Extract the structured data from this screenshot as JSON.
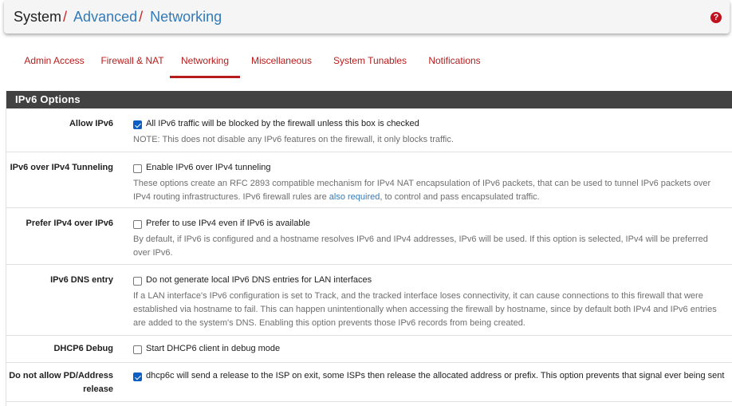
{
  "breadcrumb": {
    "root": "System",
    "separator": "/",
    "items": [
      "Advanced",
      "Networking"
    ]
  },
  "header": {
    "help_icon": "question-circle-icon",
    "help_glyph": "?"
  },
  "tabs": [
    {
      "label": "Admin Access",
      "active": false
    },
    {
      "label": "Firewall & NAT",
      "active": false
    },
    {
      "label": "Networking",
      "active": true
    },
    {
      "label": "Miscellaneous",
      "active": false
    },
    {
      "label": "System Tunables",
      "active": false
    },
    {
      "label": "Notifications",
      "active": false
    }
  ],
  "panel": {
    "title": "IPv6 Options",
    "rows": [
      {
        "label": "Allow IPv6",
        "checkbox_label": "All IPv6 traffic will be blocked by the firewall unless this box is checked",
        "checked": true,
        "help": "NOTE: This does not disable any IPv6 features on the firewall, it only blocks traffic."
      },
      {
        "label": "IPv6 over IPv4 Tunneling",
        "checkbox_label": "Enable IPv6 over IPv4 tunneling",
        "checked": false,
        "help_before": "These options create an RFC 2893 compatible mechanism for IPv4 NAT encapsulation of IPv6 packets, that can be used to tunnel IPv6 packets over IPv4 routing infrastructures. IPv6 firewall rules are ",
        "help_link": "also required",
        "help_after": ", to control and pass encapsulated traffic."
      },
      {
        "label": "Prefer IPv4 over IPv6",
        "checkbox_label": "Prefer to use IPv4 even if IPv6 is available",
        "checked": false,
        "help": "By default, if IPv6 is configured and a hostname resolves IPv6 and IPv4 addresses, IPv6 will be used. If this option is selected, IPv4 will be preferred over IPv6."
      },
      {
        "label": "IPv6 DNS entry",
        "checkbox_label": "Do not generate local IPv6 DNS entries for LAN interfaces",
        "checked": false,
        "help": "If a LAN interface's IPv6 configuration is set to Track, and the tracked interface loses connectivity, it can cause connections to this firewall that were established via hostname to fail. This can happen unintentionally when accessing the firewall by hostname, since by default both IPv4 and IPv6 entries are added to the system's DNS. Enabling this option prevents those IPv6 records from being created."
      },
      {
        "label": "DHCP6 Debug",
        "checkbox_label": "Start DHCP6 client in debug mode",
        "checked": false,
        "help": ""
      },
      {
        "label_line1": "Do not allow PD/Address",
        "label_line2": "release",
        "checkbox_label": "dhcp6c will send a release to the ISP on exit, some ISPs then release the allocated address or prefix. This option prevents that signal ever being sent",
        "checked": true,
        "help": ""
      }
    ]
  }
}
